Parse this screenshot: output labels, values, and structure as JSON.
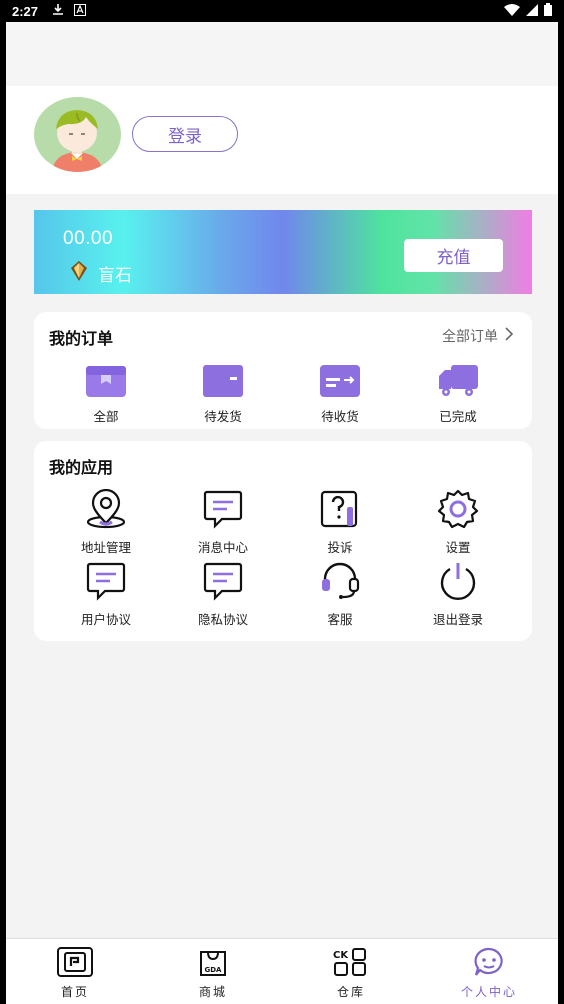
{
  "statusbar": {
    "time": "2:27"
  },
  "profile": {
    "login_label": "登录"
  },
  "balance": {
    "amount": "00.00",
    "currency_label": "盲石",
    "recharge_label": "充值"
  },
  "orders": {
    "title": "我的订单",
    "all_label": "全部订单",
    "items": [
      {
        "label": "全部",
        "icon": "box-icon"
      },
      {
        "label": "待发货",
        "icon": "wallet-icon"
      },
      {
        "label": "待收货",
        "icon": "receive-icon"
      },
      {
        "label": "已完成",
        "icon": "truck-icon"
      }
    ]
  },
  "apps": {
    "title": "我的应用",
    "items": [
      {
        "label": "地址管理",
        "icon": "location-pin-icon"
      },
      {
        "label": "消息中心",
        "icon": "message-icon"
      },
      {
        "label": "投诉",
        "icon": "complaint-icon"
      },
      {
        "label": "设置",
        "icon": "gear-icon"
      },
      {
        "label": "用户协议",
        "icon": "user-agreement-icon"
      },
      {
        "label": "隐私协议",
        "icon": "privacy-agreement-icon"
      },
      {
        "label": "客服",
        "icon": "headset-icon"
      },
      {
        "label": "退出登录",
        "icon": "power-icon"
      }
    ]
  },
  "tabs": [
    {
      "label": "首页",
      "icon": "home-icon",
      "active": false
    },
    {
      "label": "商城",
      "icon": "shop-bag-icon",
      "active": false,
      "icon_text": "GDA"
    },
    {
      "label": "仓库",
      "icon": "warehouse-icon",
      "active": false,
      "icon_text": "CK"
    },
    {
      "label": "个人中心",
      "icon": "profile-chat-icon",
      "active": true
    }
  ],
  "colors": {
    "accent": "#7d62c8",
    "icon_purple": "#8e6fe0"
  }
}
